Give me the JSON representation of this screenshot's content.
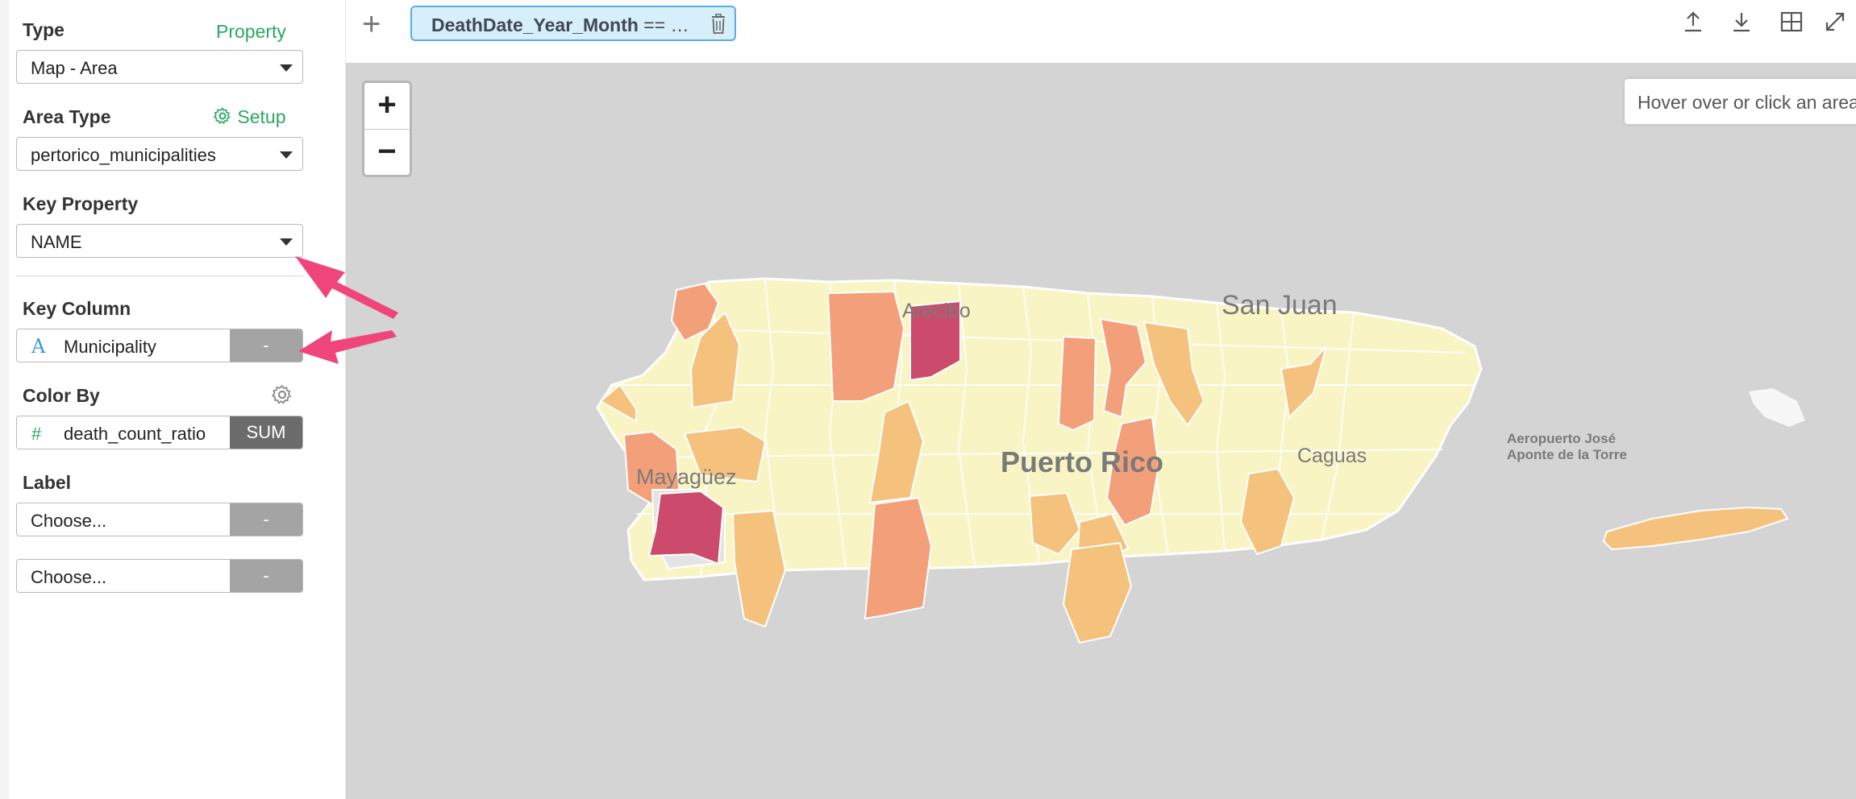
{
  "left_panel": {
    "type": {
      "label": "Type",
      "link": "Property",
      "value": "Map - Area"
    },
    "area_type": {
      "label": "Area Type",
      "link": "Setup",
      "value": "pertorico_municipalities"
    },
    "key_property": {
      "label": "Key Property",
      "value": "NAME"
    },
    "key_column": {
      "label": "Key Column",
      "type_icon": "A",
      "value": "Municipality",
      "agg": "-"
    },
    "color_by": {
      "label": "Color By",
      "type_icon": "#",
      "value": "death_count_ratio",
      "agg": "SUM"
    },
    "label": {
      "label": "Label",
      "fields": [
        {
          "value": "Choose...",
          "agg": "-"
        },
        {
          "value": "Choose...",
          "agg": "-"
        }
      ]
    }
  },
  "toolbar": {
    "add_icon": "+",
    "filter_chip": {
      "field": "DeathDate_Year_Month",
      "rest": " == …"
    }
  },
  "map": {
    "zoom_in": "+",
    "zoom_out": "−",
    "hover_text": "Hover over or click an area",
    "labels": {
      "arecibo": "Arecibo",
      "san_juan": "San Juan",
      "puerto_rico": "Puerto Rico",
      "mayaguez": "Mayagüez",
      "caguas": "Caguas",
      "airport_line1": "Aeropuerto José",
      "airport_line2": "Aponte de la Torre"
    }
  },
  "colors": {
    "accent_green": "#2aa864",
    "chip_bg": "#d7eefb",
    "chip_border": "#5aaee3",
    "arrow": "#f0457a",
    "map_low": "#f9f4c4",
    "map_mid": "#f5c27e",
    "map_high": "#f3a07a",
    "map_max": "#cc4b6c",
    "map_null": "#e4e4e4",
    "map_bg": "#d4d4d4"
  }
}
